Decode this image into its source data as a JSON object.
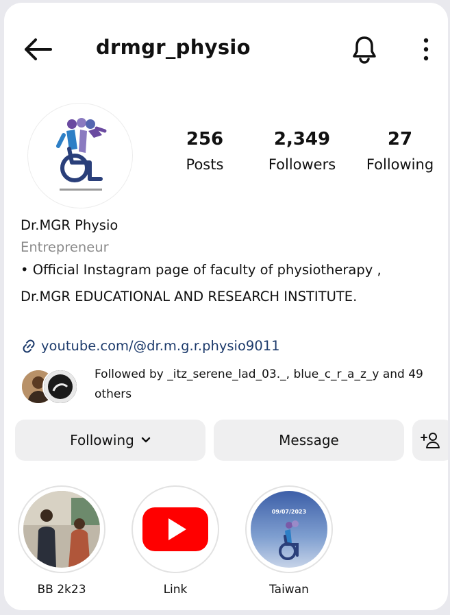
{
  "header": {
    "username": "drmgr_physio",
    "back_icon": "arrow-left-icon",
    "bell_icon": "bell-icon",
    "more_icon": "more-vertical-icon"
  },
  "stats": [
    {
      "value": "256",
      "label": "Posts"
    },
    {
      "value": "2,349",
      "label": "Followers"
    },
    {
      "value": "27",
      "label": "Following"
    }
  ],
  "bio": {
    "name": "Dr.MGR Physio",
    "category": "Entrepreneur",
    "text": "• Official Instagram page of faculty of physiotherapy , Dr.MGR EDUCATIONAL AND RESEARCH INSTITUTE.",
    "link": "youtube.com/@dr.m.g.r.physio9011"
  },
  "followed_by": {
    "text": "Followed by _itz_serene_lad_03._, blue_c_r_a_z_y and 49 others"
  },
  "actions": {
    "following": "Following",
    "message": "Message"
  },
  "highlights": [
    {
      "label": "BB 2k23"
    },
    {
      "label": "Link"
    },
    {
      "label": "Taiwan",
      "overlay_text": "09/07/2023"
    }
  ],
  "colors": {
    "link": "#1c3a6b",
    "category": "#8a8a8a",
    "button_bg": "#efeff0",
    "youtube_red": "#ff0000"
  }
}
